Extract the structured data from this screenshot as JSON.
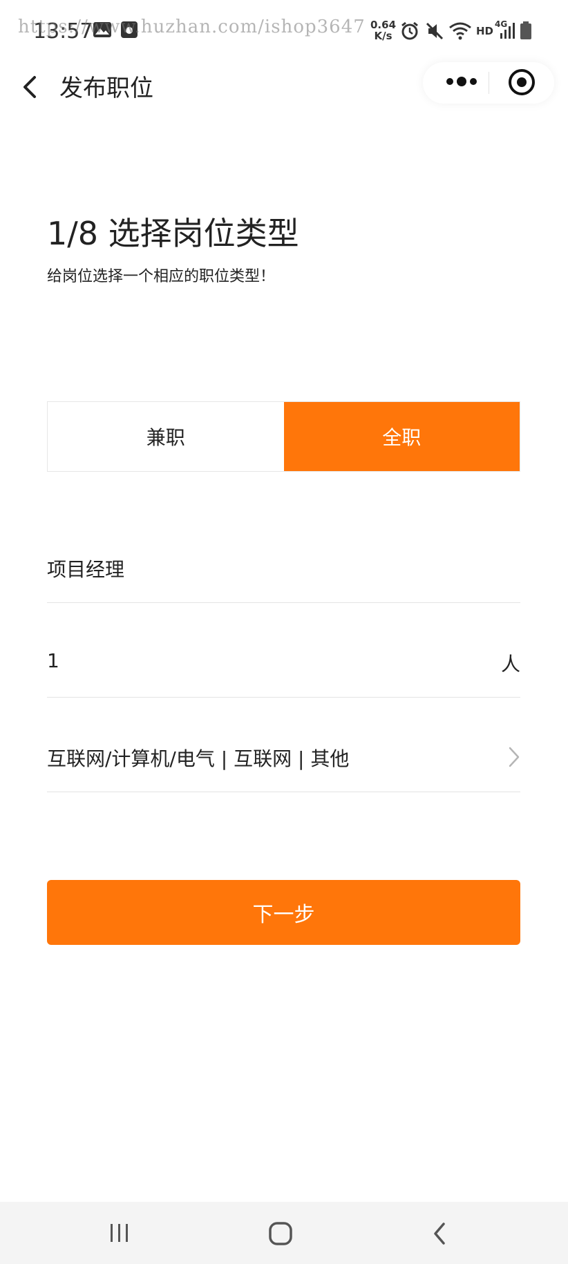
{
  "status_bar": {
    "time": "13:57",
    "watermark": "https://www.huzhan.com/ishop3647",
    "speed_value": "0.64",
    "speed_unit": "K/s",
    "network_label": "HD",
    "network_type": "4G",
    "icons": [
      "image-icon",
      "app-icon",
      "alarm-icon",
      "mute-icon",
      "wifi-icon",
      "signal-icon",
      "battery-icon"
    ]
  },
  "nav": {
    "title": "发布职位",
    "icons": [
      "back-arrow-icon",
      "more-dots-icon",
      "close-target-icon"
    ]
  },
  "step": {
    "title": "1/8 选择岗位类型",
    "subtitle": "给岗位选择一个相应的职位类型！"
  },
  "job_type": {
    "options": [
      "兼职",
      "全职"
    ],
    "selected": "全职",
    "accent_color": "#ff760a"
  },
  "form": {
    "job_name": "项目经理",
    "headcount": "1",
    "headcount_unit": "人",
    "category": "互联网/计算机/电气 | 互联网 | 其他"
  },
  "next_button": {
    "label": "下一步"
  },
  "android_nav": {
    "icons": [
      "recent-apps-icon",
      "home-icon",
      "back-icon"
    ]
  }
}
